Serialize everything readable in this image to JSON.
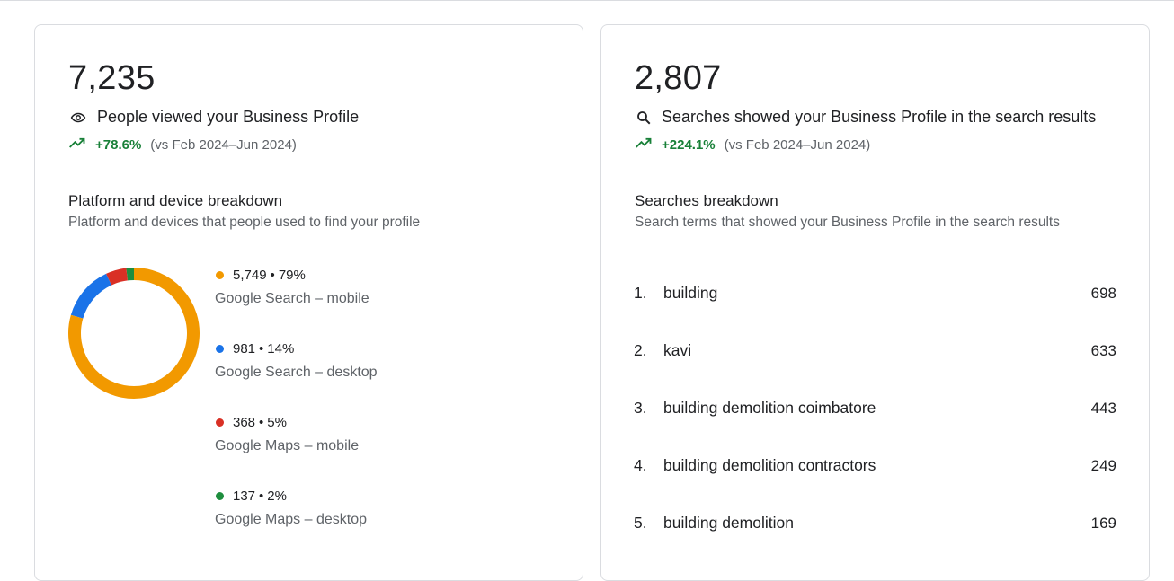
{
  "profile_views": {
    "value": "7,235",
    "icon": "eye-icon",
    "label": "People viewed your Business Profile",
    "trend_pct": "+78.6%",
    "trend_compare": "(vs Feb 2024–Jun 2024)",
    "breakdown_title": "Platform and device breakdown",
    "breakdown_subtitle": "Platform and devices that people used to find your profile",
    "platforms": [
      {
        "count": "5,749",
        "pct": "79%",
        "label": "Google Search – mobile",
        "color": "#f29900",
        "value": 5749
      },
      {
        "count": "981",
        "pct": "14%",
        "label": "Google Search – desktop",
        "color": "#1a73e8",
        "value": 981
      },
      {
        "count": "368",
        "pct": "5%",
        "label": "Google Maps – mobile",
        "color": "#d93025",
        "value": 368
      },
      {
        "count": "137",
        "pct": "2%",
        "label": "Google Maps – desktop",
        "color": "#1e8e3e",
        "value": 137
      }
    ]
  },
  "searches": {
    "value": "2,807",
    "icon": "search-icon",
    "label": "Searches showed your Business Profile in the search results",
    "trend_pct": "+224.1%",
    "trend_compare": "(vs Feb 2024–Jun 2024)",
    "breakdown_title": "Searches breakdown",
    "breakdown_subtitle": "Search terms that showed your Business Profile in the search results",
    "terms": [
      {
        "rank": "1.",
        "term": "building",
        "count": "698"
      },
      {
        "rank": "2.",
        "term": "kavi",
        "count": "633"
      },
      {
        "rank": "3.",
        "term": "building demolition coimbatore",
        "count": "443"
      },
      {
        "rank": "4.",
        "term": "building demolition contractors",
        "count": "249"
      },
      {
        "rank": "5.",
        "term": "building demolition",
        "count": "169"
      }
    ]
  },
  "colors": {
    "trend_up": "#188038",
    "text_secondary": "#5f6368"
  }
}
